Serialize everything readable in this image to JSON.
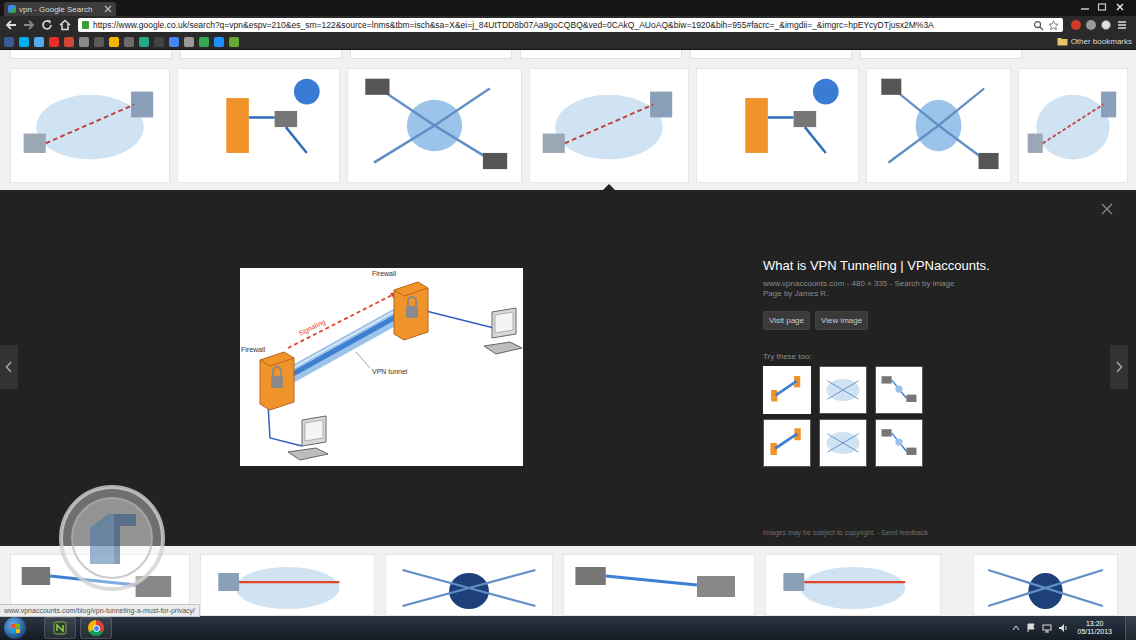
{
  "window": {
    "title": "vpn - Google Search"
  },
  "browser": {
    "url": "https://www.google.co.uk/search?q=vpn&espv=210&es_sm=122&source=lnms&tbm=isch&sa=X&ei=j_84UtTDD8b07Aa9goCQBQ&ved=0CAkQ_AUoAQ&biw=1920&bih=955#facrc=_&imgdii=_&imgrc=hpEYcyDTjusx2M%3A",
    "bookmarks": [
      {
        "color": "#3b5998"
      },
      {
        "color": "#00aff0"
      },
      {
        "color": "#55acee"
      },
      {
        "color": "#e52d27"
      },
      {
        "color": "#d14836"
      },
      {
        "color": "#8a8a8a"
      },
      {
        "color": "#5a5a5a"
      },
      {
        "color": "#f4b400"
      },
      {
        "color": "#6b6b6b"
      },
      {
        "color": "#22aa88"
      },
      {
        "color": "#444444"
      },
      {
        "color": "#4285f4"
      },
      {
        "color": "#9a9a9a"
      },
      {
        "color": "#34a853"
      },
      {
        "color": "#1e90ff"
      },
      {
        "color": "#66aa33"
      }
    ],
    "other_bookmarks": "Other bookmarks"
  },
  "results": {
    "top_row": [
      {
        "selected": false
      },
      {
        "selected": false
      },
      {
        "selected": false
      },
      {
        "selected": true
      },
      {
        "selected": false
      },
      {
        "selected": false
      },
      {
        "selected": false
      }
    ],
    "bottom_row": [
      {
        "selected": false
      },
      {
        "selected": false
      },
      {
        "selected": false
      },
      {
        "selected": false
      },
      {
        "selected": false
      },
      {
        "selected": false
      }
    ]
  },
  "preview": {
    "title": "What is VPN Tunneling | VPNaccounts.",
    "source": "www.vpnaccounts.com - 480 × 335 - Search by image",
    "author": "Page by James R.",
    "buttons": [
      "Visit page",
      "View image"
    ],
    "image": {
      "firewall_top": "Firewall",
      "firewall_left": "Firewall",
      "signaling": "Signaling",
      "tunnel": "VPN tunnel"
    },
    "related_title": "Try these too:",
    "related": [
      {
        "selected": true
      },
      {
        "selected": false
      },
      {
        "selected": false
      },
      {
        "selected": false
      },
      {
        "selected": false
      },
      {
        "selected": false
      }
    ],
    "footer": "Images may be subject to copyright. - Send feedback"
  },
  "status_bar": {
    "link": "www.vpnaccounts.com/blog/vpn-tunneling-a-must-for-privacy/"
  },
  "taskbar": {
    "time": "13:20",
    "date": "05/11/2013"
  }
}
